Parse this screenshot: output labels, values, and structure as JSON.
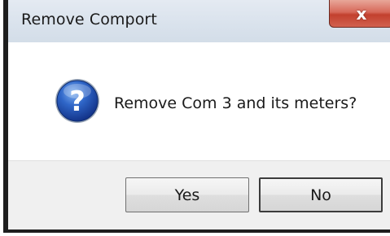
{
  "window": {
    "title": "Remove Comport",
    "close_glyph": "x"
  },
  "dialog": {
    "icon": "question-icon",
    "message": "Remove Com 3 and its meters?"
  },
  "buttons": {
    "yes_label": "Yes",
    "no_label": "No"
  },
  "colors": {
    "close_button": "#c7493a",
    "question_icon": "#1f4fa8",
    "footer": "#f0f0f0"
  }
}
